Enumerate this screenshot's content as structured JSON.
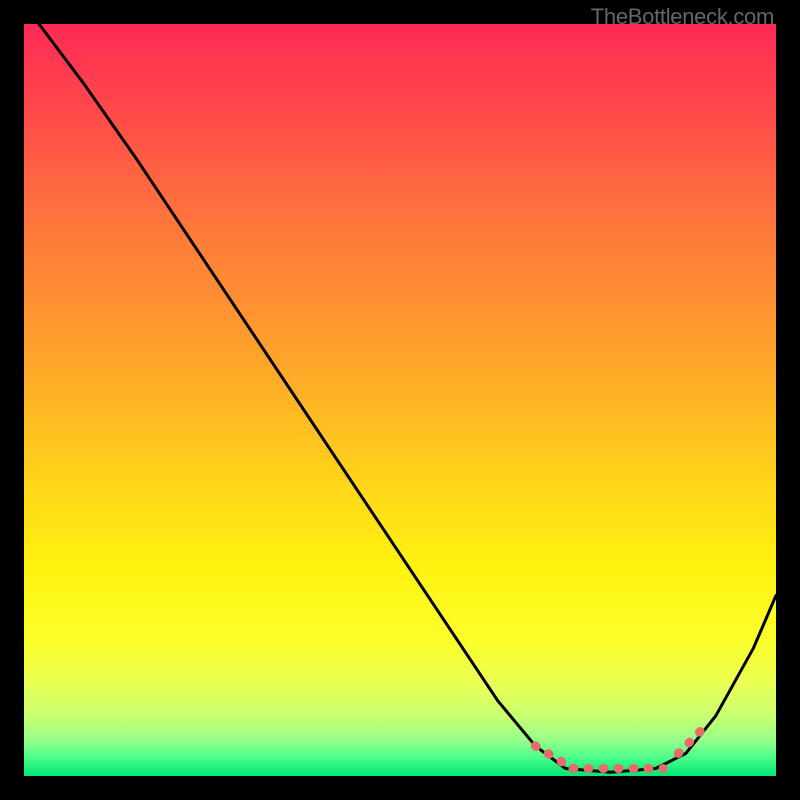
{
  "watermark": "TheBottleneck.com",
  "chart_data": {
    "type": "line",
    "title": "",
    "xlabel": "",
    "ylabel": "",
    "xlim": [
      0,
      100
    ],
    "ylim": [
      0,
      100
    ],
    "curve_points": [
      {
        "x": 2,
        "y": 100
      },
      {
        "x": 8,
        "y": 92
      },
      {
        "x": 15,
        "y": 82
      },
      {
        "x": 25,
        "y": 67
      },
      {
        "x": 35,
        "y": 52
      },
      {
        "x": 45,
        "y": 37
      },
      {
        "x": 55,
        "y": 22
      },
      {
        "x": 63,
        "y": 10
      },
      {
        "x": 68,
        "y": 4
      },
      {
        "x": 72,
        "y": 1
      },
      {
        "x": 78,
        "y": 0.5
      },
      {
        "x": 84,
        "y": 1
      },
      {
        "x": 88,
        "y": 3
      },
      {
        "x": 92,
        "y": 8
      },
      {
        "x": 97,
        "y": 17
      },
      {
        "x": 100,
        "y": 24
      }
    ],
    "highlight_segments": [
      {
        "x_start": 68,
        "x_end": 73,
        "y_start": 4,
        "y_end": 1
      },
      {
        "x_start": 73,
        "x_end": 85,
        "y_start": 1,
        "y_end": 1
      },
      {
        "x_start": 87,
        "x_end": 91,
        "y_start": 3,
        "y_end": 7
      }
    ],
    "gradient_stops": [
      {
        "offset": 0.0,
        "color": "#ff2a55"
      },
      {
        "offset": 0.12,
        "color": "#ff4a4a"
      },
      {
        "offset": 0.28,
        "color": "#ff7a3a"
      },
      {
        "offset": 0.45,
        "color": "#ffa52a"
      },
      {
        "offset": 0.6,
        "color": "#ffd21a"
      },
      {
        "offset": 0.72,
        "color": "#fff210"
      },
      {
        "offset": 0.82,
        "color": "#fbff2a"
      },
      {
        "offset": 0.88,
        "color": "#e8ff55"
      },
      {
        "offset": 0.92,
        "color": "#c8ff70"
      },
      {
        "offset": 0.95,
        "color": "#9aff88"
      },
      {
        "offset": 0.975,
        "color": "#4dff8a"
      },
      {
        "offset": 1.0,
        "color": "#00e676"
      }
    ]
  }
}
